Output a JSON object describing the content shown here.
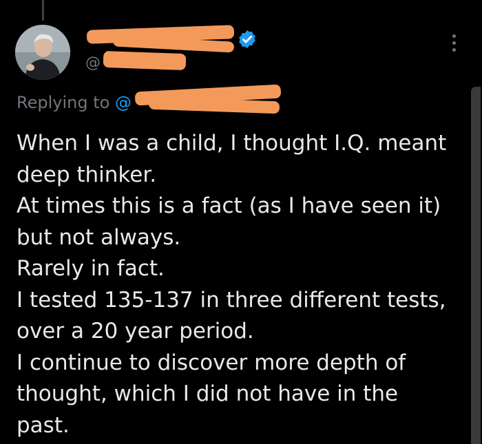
{
  "tweet": {
    "author_name": "",
    "handle": "@",
    "verified": true,
    "replying_to_label": "Replying to",
    "replying_to_handle": "@",
    "text_lines": [
      "When I was a child, I thought I.Q. meant",
      "deep thinker.",
      "At times this is a fact (as I have seen it)",
      "but not always.",
      "Rarely in fact.",
      "I tested 135-137 in three different tests,",
      "over a 20 year period.",
      "I continue to discover more depth of",
      "thought, which I did not have in the",
      "past."
    ]
  },
  "icons": {
    "verified": "verified-badge-icon",
    "more": "more-options-icon",
    "avatar": "profile-photo"
  },
  "colors": {
    "background": "#000000",
    "text": "#e7e9ea",
    "secondary_text": "#71767b",
    "link": "#1d9bf0",
    "redaction": "#f39a5b"
  }
}
